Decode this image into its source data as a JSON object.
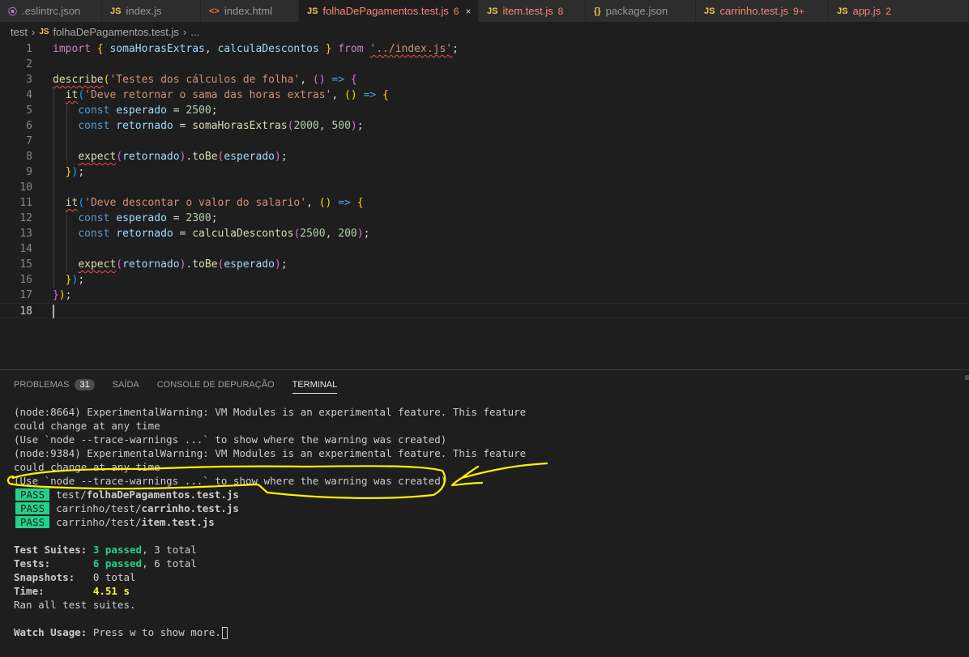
{
  "tabs": [
    {
      "label": ".eslintrc.json",
      "icon": "⦿",
      "icon_class": "c-eslint",
      "label_class": "",
      "badge": "",
      "width": 126,
      "active": false,
      "close": false
    },
    {
      "label": "index.js",
      "icon": "JS",
      "icon_class": "c-js",
      "label_class": "",
      "badge": "",
      "width": 122,
      "active": false,
      "close": false
    },
    {
      "label": "index.html",
      "icon": "<>",
      "icon_class": "c-html",
      "label_class": "",
      "badge": "",
      "width": 121,
      "active": false,
      "close": false
    },
    {
      "label": "folhaDePagamentos.test.js",
      "icon": "JS",
      "icon_class": "c-js",
      "label_class": "c-err",
      "badge": "6",
      "width": 222,
      "active": true,
      "close": true
    },
    {
      "label": "item.test.js",
      "icon": "JS",
      "icon_class": "c-js",
      "label_class": "c-err",
      "badge": "8",
      "width": 132,
      "active": false,
      "close": false
    },
    {
      "label": "package.json",
      "icon": "{}",
      "icon_class": "c-json",
      "label_class": "",
      "badge": "",
      "width": 136,
      "active": false,
      "close": false
    },
    {
      "label": "carrinho.test.js",
      "icon": "JS",
      "icon_class": "c-js",
      "label_class": "c-err",
      "badge": "9+",
      "width": 164,
      "active": false,
      "close": false
    },
    {
      "label": "app.js",
      "icon": "JS",
      "icon_class": "c-js",
      "label_class": "c-err",
      "badge": "2",
      "width": 173,
      "active": false,
      "close": false
    }
  ],
  "breadcrumb": {
    "folder": "test",
    "file_icon": "JS",
    "file": "folhaDePagamentos.test.js",
    "ellipsis": "..."
  },
  "editor": {
    "lines": [
      {
        "n": "1",
        "tokens": [
          [
            "kw2",
            "import"
          ],
          [
            "pl",
            " "
          ],
          [
            "p1",
            "{"
          ],
          [
            "pl",
            " "
          ],
          [
            "var",
            "somaHorasExtras"
          ],
          [
            "pl",
            ", "
          ],
          [
            "var",
            "calculaDescontos"
          ],
          [
            "pl",
            " "
          ],
          [
            "p1",
            "}"
          ],
          [
            "pl",
            " "
          ],
          [
            "kw2",
            "from"
          ],
          [
            "pl",
            " "
          ],
          [
            "str squig",
            "'../index.js'"
          ],
          [
            "pl",
            ";"
          ]
        ]
      },
      {
        "n": "2",
        "tokens": []
      },
      {
        "n": "3",
        "tokens": [
          [
            "fn squig",
            "describe"
          ],
          [
            "p1",
            "("
          ],
          [
            "str",
            "'Testes dos cálculos de folha'"
          ],
          [
            "pl",
            ", "
          ],
          [
            "p2",
            "()"
          ],
          [
            "pl",
            " "
          ],
          [
            "arr",
            "=>"
          ],
          [
            "pl",
            " "
          ],
          [
            "p2",
            "{"
          ]
        ]
      },
      {
        "n": "4",
        "tokens": [
          [
            "pl",
            "  "
          ],
          [
            "fn squig",
            "it"
          ],
          [
            "p3",
            "("
          ],
          [
            "str",
            "'Deve retornar o sama das horas extras'"
          ],
          [
            "pl",
            ", "
          ],
          [
            "p1",
            "()"
          ],
          [
            "pl",
            " "
          ],
          [
            "arr",
            "=>"
          ],
          [
            "pl",
            " "
          ],
          [
            "p1",
            "{"
          ]
        ]
      },
      {
        "n": "5",
        "tokens": [
          [
            "pl",
            "    "
          ],
          [
            "kw",
            "const"
          ],
          [
            "pl",
            " "
          ],
          [
            "var",
            "esperado"
          ],
          [
            "pl",
            " = "
          ],
          [
            "num",
            "2500"
          ],
          [
            "pl",
            ";"
          ]
        ]
      },
      {
        "n": "6",
        "tokens": [
          [
            "pl",
            "    "
          ],
          [
            "kw",
            "const"
          ],
          [
            "pl",
            " "
          ],
          [
            "var",
            "retornado"
          ],
          [
            "pl",
            " = "
          ],
          [
            "fn",
            "somaHorasExtras"
          ],
          [
            "p2",
            "("
          ],
          [
            "num",
            "2000"
          ],
          [
            "pl",
            ", "
          ],
          [
            "num",
            "500"
          ],
          [
            "p2",
            ")"
          ],
          [
            "pl",
            ";"
          ]
        ]
      },
      {
        "n": "7",
        "tokens": []
      },
      {
        "n": "8",
        "tokens": [
          [
            "pl",
            "    "
          ],
          [
            "fn squig",
            "expect"
          ],
          [
            "p2",
            "("
          ],
          [
            "var",
            "retornado"
          ],
          [
            "p2",
            ")"
          ],
          [
            "pl",
            "."
          ],
          [
            "fn",
            "toBe"
          ],
          [
            "p2",
            "("
          ],
          [
            "var",
            "esperado"
          ],
          [
            "p2",
            ")"
          ],
          [
            "pl",
            ";"
          ]
        ]
      },
      {
        "n": "9",
        "tokens": [
          [
            "pl",
            "  "
          ],
          [
            "p1",
            "}"
          ],
          [
            "p3",
            ")"
          ],
          [
            "pl",
            ";"
          ]
        ]
      },
      {
        "n": "10",
        "tokens": []
      },
      {
        "n": "11",
        "tokens": [
          [
            "pl",
            "  "
          ],
          [
            "fn squig",
            "it"
          ],
          [
            "p3",
            "("
          ],
          [
            "str",
            "'Deve descontar o valor do salario'"
          ],
          [
            "pl",
            ", "
          ],
          [
            "p1",
            "()"
          ],
          [
            "pl",
            " "
          ],
          [
            "arr",
            "=>"
          ],
          [
            "pl",
            " "
          ],
          [
            "p1",
            "{"
          ]
        ]
      },
      {
        "n": "12",
        "tokens": [
          [
            "pl",
            "    "
          ],
          [
            "kw",
            "const"
          ],
          [
            "pl",
            " "
          ],
          [
            "var",
            "esperado"
          ],
          [
            "pl",
            " = "
          ],
          [
            "num",
            "2300"
          ],
          [
            "pl",
            ";"
          ]
        ]
      },
      {
        "n": "13",
        "tokens": [
          [
            "pl",
            "    "
          ],
          [
            "kw",
            "const"
          ],
          [
            "pl",
            " "
          ],
          [
            "var",
            "retornado"
          ],
          [
            "pl",
            " = "
          ],
          [
            "fn",
            "calculaDescontos"
          ],
          [
            "p2",
            "("
          ],
          [
            "num",
            "2500"
          ],
          [
            "pl",
            ", "
          ],
          [
            "num",
            "200"
          ],
          [
            "p2",
            ")"
          ],
          [
            "pl",
            ";"
          ]
        ]
      },
      {
        "n": "14",
        "tokens": []
      },
      {
        "n": "15",
        "tokens": [
          [
            "pl",
            "    "
          ],
          [
            "fn squig",
            "expect"
          ],
          [
            "p2",
            "("
          ],
          [
            "var",
            "retornado"
          ],
          [
            "p2",
            ")"
          ],
          [
            "pl",
            "."
          ],
          [
            "fn",
            "toBe"
          ],
          [
            "p2",
            "("
          ],
          [
            "var",
            "esperado"
          ],
          [
            "p2",
            ")"
          ],
          [
            "pl",
            ";"
          ]
        ]
      },
      {
        "n": "16",
        "tokens": [
          [
            "pl",
            "  "
          ],
          [
            "p1",
            "}"
          ],
          [
            "p3",
            ")"
          ],
          [
            "pl",
            ";"
          ]
        ]
      },
      {
        "n": "17",
        "tokens": [
          [
            "p2",
            "}"
          ],
          [
            "p1",
            ")"
          ],
          [
            "pl",
            ";"
          ]
        ]
      },
      {
        "n": "18",
        "tokens": []
      }
    ],
    "current_line": "18"
  },
  "panel": {
    "tabs": [
      {
        "label": "PROBLEMAS",
        "badge": "31",
        "active": false
      },
      {
        "label": "SAÍDA",
        "badge": "",
        "active": false
      },
      {
        "label": "CONSOLE DE DEPURAÇÃO",
        "badge": "",
        "active": false
      },
      {
        "label": "TERMINAL",
        "badge": "",
        "active": true
      }
    ]
  },
  "terminal": {
    "lines": [
      [
        [
          "",
          "(node:8664) ExperimentalWarning: VM Modules is an experimental feature. This feature"
        ]
      ],
      [
        [
          "",
          "could change at any time"
        ]
      ],
      [
        [
          "",
          "(Use `node --trace-warnings ...` to show where the warning was created)"
        ]
      ],
      [
        [
          "",
          "(node:9384) ExperimentalWarning: VM Modules is an experimental feature. This feature"
        ]
      ],
      [
        [
          "",
          "could change at any time"
        ]
      ],
      [
        [
          "",
          "(Use `node --trace-warnings ...` to show where the warning was created)"
        ]
      ],
      [
        [
          "pass",
          "PASS"
        ],
        [
          "",
          "test/"
        ],
        [
          "b",
          "folhaDePagamentos.test.js"
        ]
      ],
      [
        [
          "pass",
          "PASS"
        ],
        [
          "",
          "carrinho/test/"
        ],
        [
          "b",
          "carrinho.test.js"
        ]
      ],
      [
        [
          "pass",
          "PASS"
        ],
        [
          "",
          "carrinho/test/"
        ],
        [
          "b",
          "item.test.js"
        ]
      ],
      [],
      [
        [
          "b",
          "Test Suites: "
        ],
        [
          "green",
          "3 passed"
        ],
        [
          "",
          ", 3 total"
        ]
      ],
      [
        [
          "b",
          "Tests:       "
        ],
        [
          "green",
          "6 passed"
        ],
        [
          "",
          ", 6 total"
        ]
      ],
      [
        [
          "b",
          "Snapshots:   "
        ],
        [
          "",
          "0 total"
        ]
      ],
      [
        [
          "b",
          "Time:        "
        ],
        [
          "yellow",
          "4.51 s"
        ]
      ],
      [
        [
          "",
          "Ran all test suites."
        ]
      ],
      [],
      [
        [
          "b",
          "Watch Usage: "
        ],
        [
          "",
          "Press w to show more."
        ],
        [
          "cursor",
          ""
        ]
      ]
    ]
  }
}
